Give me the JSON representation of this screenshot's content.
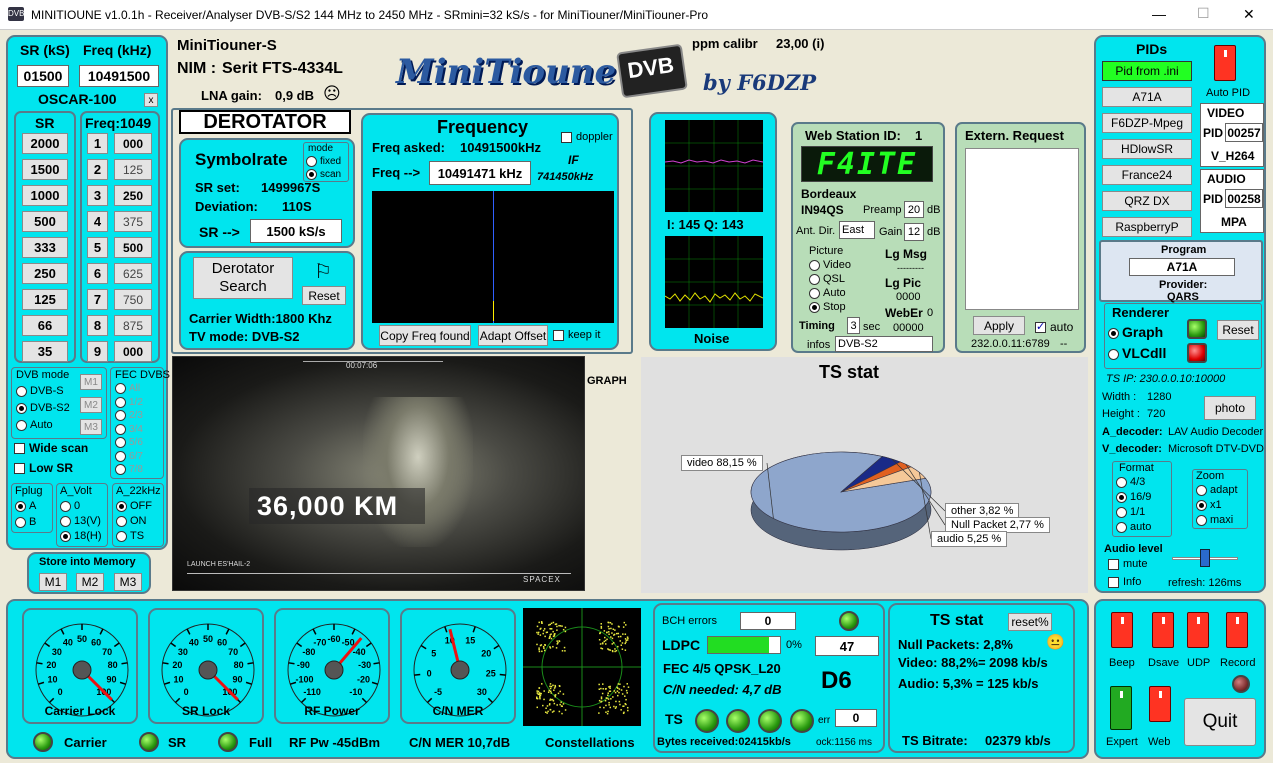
{
  "window": {
    "title": "MINITIOUNE v1.0.1h - Receiver/Analyser DVB-S/S2 144 MHz to 2450 MHz - SRmini=32 kS/s - for MiniTiouner/MiniTiouner-Pro",
    "min": "—",
    "max": "☐",
    "close": "✕"
  },
  "left": {
    "sr_label": "SR (kS)",
    "freq_label": "Freq (kHz)",
    "sr_value": "01500",
    "freq_value": "10491500",
    "preset": "OSCAR-100",
    "preset_close": "x",
    "sr_col_label": "SR",
    "freq_col_label": "Freq:1049",
    "sr_buttons": [
      "2000",
      "1500",
      "1000",
      "500",
      "333",
      "250",
      "125",
      "66",
      "35"
    ],
    "freq_numbers": [
      "1",
      "2",
      "3",
      "4",
      "5",
      "6",
      "7",
      "8",
      "9"
    ],
    "freq_buttons": [
      "000",
      "125",
      "250",
      "375",
      "500",
      "625",
      "750",
      "875",
      "000"
    ],
    "dvb_mode_label": "DVB mode",
    "dvb_modes": [
      "DVB-S",
      "DVB-S2",
      "Auto"
    ],
    "mem_buttons": [
      "M1",
      "M2",
      "M3"
    ],
    "fec_label": "FEC DVBS",
    "fec_options": [
      "All",
      "1/2",
      "2/3",
      "3/4",
      "5/6",
      "6/7",
      "7/8"
    ],
    "wide_scan": "Wide scan",
    "low_sr": "Low SR",
    "fplug_label": "Fplug",
    "fplug_options": [
      "A",
      "B"
    ],
    "avolt_label": "A_Volt",
    "avolt_options": [
      "0",
      "13(V)",
      "18(H)"
    ],
    "a22_label": "A_22kHz",
    "a22_options": [
      "OFF",
      "ON",
      "TS"
    ],
    "store_label": "Store into Memory",
    "store_buttons": [
      "M1",
      "M2",
      "M3"
    ]
  },
  "header": {
    "device": "MiniTiouner-S",
    "nim_label": "NIM :",
    "nim_value": "Serit FTS-4334L",
    "lna_label": "LNA gain:",
    "lna_value": "0,9 dB",
    "lna_icon": "☹",
    "logo": "MiniTioune",
    "logo_dvb": "DVB",
    "logo_by": "by F6DZP",
    "ppm_label": "ppm calibr",
    "ppm_value": "23,00 (i)"
  },
  "derotator": {
    "title": "DEROTATOR",
    "symbolrate_title": "Symbolrate",
    "mode_label": "mode",
    "mode_fixed": "fixed",
    "mode_scan": "scan",
    "sr_set_label": "SR set:",
    "sr_set_value": "1499967S",
    "deviation_label": "Deviation:",
    "deviation_value": "110S",
    "sr_arrow": "SR -->",
    "sr_value": "1500 kS/s",
    "search_button": "Derotator Search",
    "flag_icon": "⚐",
    "reset_button": "Reset",
    "carrier_width": "Carrier Width:1800 Khz",
    "tv_mode": "TV mode: DVB-S2"
  },
  "frequency": {
    "title": "Frequency",
    "doppler": "doppler",
    "asked_label": "Freq asked:",
    "asked_value": "10491500kHz",
    "freq_arrow": "Freq -->",
    "freq_value": "10491471 kHz",
    "if_label": "IF",
    "if_value": "741450kHz",
    "copy_button": "Copy Freq found",
    "adapt_button": "Adapt Offset",
    "keep_it": "keep it"
  },
  "iq": {
    "readout": "I: 145  Q: 143",
    "noise_label": "Noise"
  },
  "webstation": {
    "title": "Web Station ID:",
    "id": "1",
    "callsign": "F4ITE",
    "city": "Bordeaux",
    "locator": "IN94QS",
    "preamp_label": "Preamp",
    "preamp_value": "20",
    "preamp_unit": "dB",
    "ant_label": "Ant. Dir.",
    "ant_value": "East",
    "gain_label": "Gain",
    "gain_value": "12",
    "gain_unit": "dB",
    "picture_label": "Picture",
    "picture_options": [
      "Video",
      "QSL",
      "Auto",
      "Stop"
    ],
    "lg_msg_label": "Lg Msg",
    "lg_msg_value": "---------",
    "lg_pic_label": "Lg Pic",
    "lg_pic_value": "0000",
    "weber_label": "WebEr",
    "weber_value": "0",
    "timing_label": "Timing",
    "timing_value": "3",
    "timing_unit": "sec",
    "timing_counter": "00000",
    "infos_label": "infos",
    "infos_value": "DVB-S2"
  },
  "extern": {
    "title": "Extern. Request",
    "apply_button": "Apply",
    "auto_label": "auto",
    "address": "232.0.0.11:6789",
    "dash": "--"
  },
  "video": {
    "overlay_text": "36,000 KM",
    "top_text": "00:07:06",
    "bottom_left": "LAUNCH ES'HAIL-2",
    "bottom_right": "SPACEX",
    "graph_label": "GRAPH"
  },
  "ts_chart": {
    "title": "TS stat"
  },
  "chart_data": {
    "type": "pie",
    "title": "TS stat",
    "categories": [
      "video",
      "other",
      "Null Packet",
      "audio"
    ],
    "values": [
      88.15,
      3.82,
      2.77,
      5.25
    ],
    "labels": [
      "video 88,15 %",
      "other 3,82 %",
      "Null Packet 2,77 %",
      "audio 5,25 %"
    ],
    "colors": [
      "#8ea6cc",
      "#1a2a88",
      "#e06020",
      "#f5c898"
    ]
  },
  "pids": {
    "title": "PIDs",
    "from_ini": "Pid from .ini",
    "channels": [
      "A71A",
      "F6DZP-Mpeg",
      "HDlowSR",
      "France24",
      "QRZ DX",
      "RaspberryP"
    ],
    "auto_pid": "Auto PID",
    "video_label": "VIDEO",
    "pid_label": "PID",
    "video_pid": "00257",
    "video_codec": "V_H264",
    "audio_label": "AUDIO",
    "audio_pid": "00258",
    "audio_codec": "MPA"
  },
  "program": {
    "label": "Program",
    "value": "A71A",
    "provider_label": "Provider:",
    "provider_value": "QARS"
  },
  "renderer": {
    "title": "Renderer",
    "graph": "Graph",
    "vlc": "VLCdll",
    "reset_button": "Reset",
    "ts_ip": "TS IP: 230.0.0.10:10000",
    "width_label": "Width :",
    "width_value": "1280",
    "height_label": "Height :",
    "height_value": "720",
    "photo_button": "photo",
    "a_decoder_label": "A_decoder:",
    "a_decoder_value": "LAV Audio Decoder",
    "v_decoder_label": "V_decoder:",
    "v_decoder_value": "Microsoft DTV-DVD V",
    "format_label": "Format",
    "format_options": [
      "4/3",
      "16/9",
      "1/1",
      "auto"
    ],
    "zoom_label": "Zoom",
    "zoom_options": [
      "adapt",
      "x1",
      "maxi"
    ],
    "audio_level": "Audio level",
    "mute": "mute",
    "info": "Info",
    "refresh": "refresh: 126ms"
  },
  "gauges": [
    {
      "label": "Carrier Lock",
      "ticks": [
        "0",
        "10",
        "20",
        "30",
        "40",
        "50",
        "60",
        "70",
        "80",
        "90",
        "100"
      ],
      "value": 100
    },
    {
      "label": "SR Lock",
      "ticks": [
        "0",
        "10",
        "20",
        "30",
        "40",
        "50",
        "60",
        "70",
        "80",
        "90",
        "100"
      ],
      "value": 100
    },
    {
      "label": "RF Power",
      "ticks": [
        "-110",
        "-100",
        "-90",
        "-80",
        "-70",
        "-60",
        "-50",
        "-40",
        "-30",
        "-20",
        "-10"
      ],
      "value": -45
    },
    {
      "label": "C/N MER",
      "ticks": [
        "-5",
        "0",
        "5",
        "10",
        "15",
        "20",
        "25",
        "30"
      ],
      "value": 10.7
    }
  ],
  "status_bar": {
    "carrier": "Carrier",
    "sr": "SR",
    "full": "Full",
    "rf_pw": "RF Pw -45dBm",
    "cn_mer": "C/N MER 10,7dB",
    "constellations": "Constellations"
  },
  "decoder": {
    "bch_label": "BCH errors",
    "bch_value": "0",
    "ldpc_label": "LDPC",
    "ldpc_percent": "0%",
    "ldpc_value": "47",
    "ldpc_fill": 0.85,
    "fec_text": "FEC 4/5 QPSK_L20",
    "cn_needed": "C/N needed: 4,7 dB",
    "d_value": "D6",
    "ts_label": "TS",
    "err_label": "err",
    "err_value": "0",
    "bytes_received": "Bytes received:02415kb/s",
    "ock": "ock:1156 ms"
  },
  "ts_stat": {
    "title": "TS stat",
    "reset_button": "reset%",
    "null_packets": "Null Packets:  2,8%",
    "smiley": "😐",
    "video": "Video: 88,2%= 2098 kb/s",
    "audio": "Audio: 5,3%  =  125 kb/s",
    "bitrate_label": "TS Bitrate:",
    "bitrate_value": "02379 kb/s"
  },
  "controls": {
    "labels": [
      "Beep",
      "Dsave",
      "UDP",
      "Record",
      "Expert",
      "Web"
    ],
    "quit_button": "Quit"
  }
}
